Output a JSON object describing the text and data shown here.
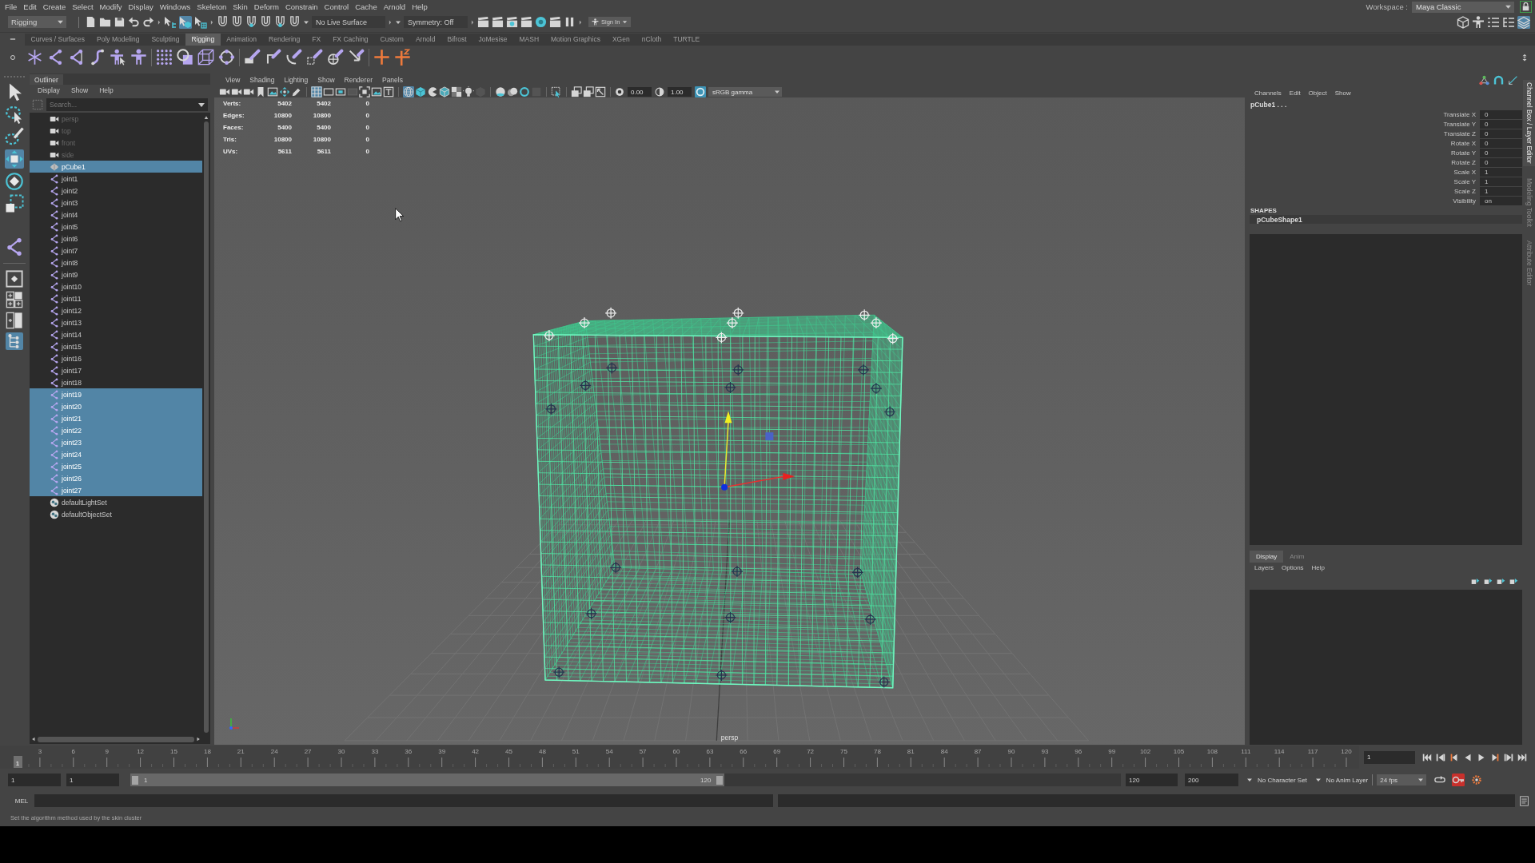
{
  "menu_bar": {
    "items": [
      "File",
      "Edit",
      "Create",
      "Select",
      "Modify",
      "Display",
      "Windows",
      "Skeleton",
      "Skin",
      "Deform",
      "Constrain",
      "Control",
      "Cache",
      "Arnold",
      "Help"
    ],
    "workspace_label": "Workspace :",
    "workspace": "Maya Classic"
  },
  "status_line": {
    "menu_set": "Rigging",
    "select_modes": [
      {
        "selected": false
      },
      {
        "selected": true
      },
      {
        "selected": false
      }
    ],
    "live_surface": "No Live Surface",
    "symmetry": "Symmetry: Off",
    "sign_in": "Sign In",
    "panel_toggles": [
      {
        "selected": false
      },
      {
        "selected": false
      },
      {
        "selected": false
      },
      {
        "selected": false
      },
      {
        "selected": true
      }
    ]
  },
  "shelf": {
    "tabs": [
      {
        "label": "Curves / Surfaces",
        "selected": false
      },
      {
        "label": "Poly Modeling",
        "selected": false
      },
      {
        "label": "Sculpting",
        "selected": false
      },
      {
        "label": "Rigging",
        "selected": true
      },
      {
        "label": "Animation",
        "selected": false
      },
      {
        "label": "Rendering",
        "selected": false
      },
      {
        "label": "FX",
        "selected": false
      },
      {
        "label": "FX Caching",
        "selected": false
      },
      {
        "label": "Custom",
        "selected": false
      },
      {
        "label": "Arnold",
        "selected": false
      },
      {
        "label": "Bifrost",
        "selected": false
      },
      {
        "label": "JoMesise",
        "selected": false
      },
      {
        "label": "MASH",
        "selected": false
      },
      {
        "label": "Motion Graphics",
        "selected": false
      },
      {
        "label": "XGen",
        "selected": false
      },
      {
        "label": "nCloth",
        "selected": false
      },
      {
        "label": "TURTLE",
        "selected": false
      }
    ]
  },
  "toolbox": [
    {
      "kind": "select",
      "selected": false
    },
    {
      "kind": "lasso",
      "selected": false
    },
    {
      "kind": "paint",
      "selected": false
    },
    {
      "kind": "move",
      "selected": true
    },
    {
      "kind": "rotate",
      "selected": false
    },
    {
      "kind": "scale",
      "selected": false
    },
    {
      "kind": "joint",
      "selected": false
    },
    {
      "kind": "single-pane",
      "selected": false
    },
    {
      "kind": "four-pane",
      "selected": false
    },
    {
      "kind": "two-pane",
      "selected": false
    },
    {
      "kind": "outliner-pane",
      "selected": true
    }
  ],
  "outliner": {
    "title": "Outliner",
    "menu": [
      "Display",
      "Show",
      "Help"
    ],
    "search": {
      "placeholder": "Search..."
    },
    "items": [
      {
        "label": "persp",
        "kind": "camera",
        "dimmed": true,
        "selected": false
      },
      {
        "label": "top",
        "kind": "camera",
        "dimmed": true,
        "selected": false
      },
      {
        "label": "front",
        "kind": "camera",
        "dimmed": true,
        "selected": false
      },
      {
        "label": "side",
        "kind": "camera",
        "dimmed": true,
        "selected": false
      },
      {
        "label": "pCube1",
        "kind": "mesh",
        "dimmed": false,
        "selected": true
      },
      {
        "label": "joint1",
        "kind": "joint",
        "dimmed": false,
        "selected": false
      },
      {
        "label": "joint2",
        "kind": "joint",
        "dimmed": false,
        "selected": false
      },
      {
        "label": "joint3",
        "kind": "joint",
        "dimmed": false,
        "selected": false
      },
      {
        "label": "joint4",
        "kind": "joint",
        "dimmed": false,
        "selected": false
      },
      {
        "label": "joint5",
        "kind": "joint",
        "dimmed": false,
        "selected": false
      },
      {
        "label": "joint6",
        "kind": "joint",
        "dimmed": false,
        "selected": false
      },
      {
        "label": "joint7",
        "kind": "joint",
        "dimmed": false,
        "selected": false
      },
      {
        "label": "joint8",
        "kind": "joint",
        "dimmed": false,
        "selected": false
      },
      {
        "label": "joint9",
        "kind": "joint",
        "dimmed": false,
        "selected": false
      },
      {
        "label": "joint10",
        "kind": "joint",
        "dimmed": false,
        "selected": false
      },
      {
        "label": "joint11",
        "kind": "joint",
        "dimmed": false,
        "selected": false
      },
      {
        "label": "joint12",
        "kind": "joint",
        "dimmed": false,
        "selected": false
      },
      {
        "label": "joint13",
        "kind": "joint",
        "dimmed": false,
        "selected": false
      },
      {
        "label": "joint14",
        "kind": "joint",
        "dimmed": false,
        "selected": false
      },
      {
        "label": "joint15",
        "kind": "joint",
        "dimmed": false,
        "selected": false
      },
      {
        "label": "joint16",
        "kind": "joint",
        "dimmed": false,
        "selected": false
      },
      {
        "label": "joint17",
        "kind": "joint",
        "dimmed": false,
        "selected": false
      },
      {
        "label": "joint18",
        "kind": "joint",
        "dimmed": false,
        "selected": false
      },
      {
        "label": "joint19",
        "kind": "joint",
        "dimmed": false,
        "selected": true
      },
      {
        "label": "joint20",
        "kind": "joint",
        "dimmed": false,
        "selected": true
      },
      {
        "label": "joint21",
        "kind": "joint",
        "dimmed": false,
        "selected": true
      },
      {
        "label": "joint22",
        "kind": "joint",
        "dimmed": false,
        "selected": true
      },
      {
        "label": "joint23",
        "kind": "joint",
        "dimmed": false,
        "selected": true
      },
      {
        "label": "joint24",
        "kind": "joint",
        "dimmed": false,
        "selected": true
      },
      {
        "label": "joint25",
        "kind": "joint",
        "dimmed": false,
        "selected": true
      },
      {
        "label": "joint26",
        "kind": "joint",
        "dimmed": false,
        "selected": true
      },
      {
        "label": "joint27",
        "kind": "joint",
        "dimmed": false,
        "selected": true
      },
      {
        "label": "defaultLightSet",
        "kind": "set",
        "dimmed": false,
        "selected": false
      },
      {
        "label": "defaultObjectSet",
        "kind": "set",
        "dimmed": false,
        "selected": false
      }
    ]
  },
  "viewport": {
    "menu": [
      "View",
      "Shading",
      "Lighting",
      "Show",
      "Renderer",
      "Panels"
    ],
    "toolbar": [
      {
        "selected": false
      },
      {
        "selected": false
      },
      {
        "selected": false
      },
      {
        "selected": false
      },
      {
        "selected": false
      },
      {
        "selected": false
      },
      {
        "selected": false
      },
      {
        "selected": true
      },
      {
        "selected": false
      },
      {
        "selected": false
      },
      {
        "selected": false
      },
      {
        "selected": false
      },
      {
        "selected": false
      },
      {
        "selected": false
      },
      {
        "selected": true
      },
      {
        "selected": false
      },
      {
        "selected": false
      },
      {
        "selected": false
      },
      {
        "selected": false
      },
      {
        "selected": false
      },
      {
        "selected": false
      },
      {
        "selected": false
      },
      {
        "selected": false
      },
      {
        "selected": false
      },
      {
        "selected": false
      },
      {
        "selected": false
      },
      {
        "selected": false
      },
      {
        "selected": false
      },
      {
        "selected": false
      }
    ],
    "exposure": "0.00",
    "gamma": "1.00",
    "color_management": {
      "on": true,
      "view": "sRGB gamma"
    },
    "hud": [
      {
        "label": "Verts:",
        "values": [
          "5402",
          "5402",
          "0"
        ]
      },
      {
        "label": "Edges:",
        "values": [
          "10800",
          "10800",
          "0"
        ]
      },
      {
        "label": "Faces:",
        "values": [
          "5400",
          "5400",
          "0"
        ]
      },
      {
        "label": "Tris:",
        "values": [
          "10800",
          "10800",
          "0"
        ]
      },
      {
        "label": "UVs:",
        "values": [
          "5611",
          "5611",
          "0"
        ]
      }
    ],
    "camera": "persp"
  },
  "channel_box": {
    "menu": [
      "Channels",
      "Edit",
      "Object",
      "Show"
    ],
    "object": "pCube1 . . .",
    "attributes": [
      {
        "name": "Translate X",
        "value": "0"
      },
      {
        "name": "Translate Y",
        "value": "0"
      },
      {
        "name": "Translate Z",
        "value": "0"
      },
      {
        "name": "Rotate X",
        "value": "0"
      },
      {
        "name": "Rotate Y",
        "value": "0"
      },
      {
        "name": "Rotate Z",
        "value": "0"
      },
      {
        "name": "Scale X",
        "value": "1"
      },
      {
        "name": "Scale Y",
        "value": "1"
      },
      {
        "name": "Scale Z",
        "value": "1"
      },
      {
        "name": "Visibility",
        "value": "on"
      }
    ],
    "shapes_heading": "SHAPES",
    "shapes": [
      "pCubeShape1"
    ]
  },
  "layer_editor": {
    "tabs": [
      {
        "label": "Display",
        "selected": true
      },
      {
        "label": "Anim",
        "selected": false
      }
    ],
    "menu": [
      "Layers",
      "Options",
      "Help"
    ]
  },
  "side_tabs": [
    {
      "label": "Channel Box / Layer Editor",
      "selected": true
    },
    {
      "label": "Modeling Toolkit",
      "selected": false
    },
    {
      "label": "Attribute Editor",
      "selected": false
    }
  ],
  "time_slider": {
    "frame_labels": [
      "3",
      "6",
      "9",
      "12",
      "15",
      "18",
      "21",
      "24",
      "27",
      "30",
      "33",
      "36",
      "39",
      "42",
      "45",
      "48",
      "51",
      "54",
      "57",
      "60",
      "63",
      "66",
      "69",
      "72",
      "75",
      "78",
      "81",
      "84",
      "87",
      "90",
      "93",
      "96",
      "99",
      "102",
      "105",
      "108",
      "111",
      "114",
      "117",
      "120"
    ],
    "current_frame": "1",
    "level": 0,
    "frame_field": "1"
  },
  "range_slider": {
    "start": "1",
    "playback_start": "1",
    "range_start_label": "1",
    "range_end_label": "120",
    "level": 0.6,
    "playback_end": "120",
    "end": "200",
    "character_set": "No Character Set",
    "anim_layer": "No Anim Layer",
    "fps": "24 fps",
    "auto_key": true
  },
  "command_line": {
    "language": "MEL"
  },
  "help_line": "Set the algorithm method used by the skin cluster"
}
